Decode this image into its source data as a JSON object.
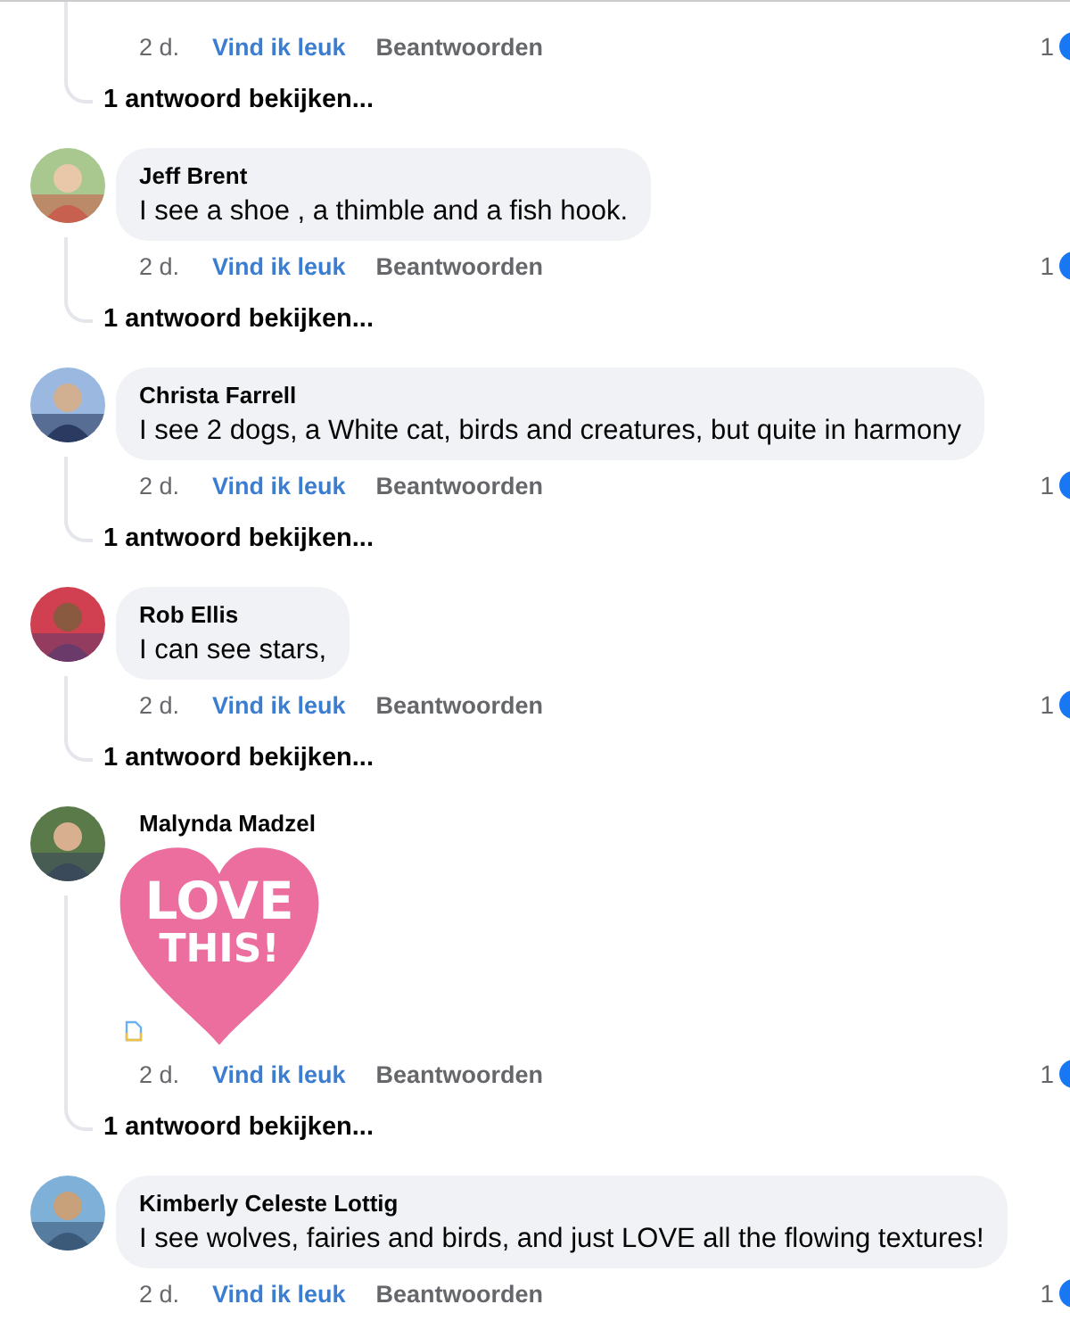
{
  "comments": [
    {
      "kind": "partial",
      "time": "2 d.",
      "like_label": "Vind ik leuk",
      "liked": true,
      "reply_label": "Beantwoorden",
      "reactions": "1",
      "replies_link": "1 antwoord bekijken..."
    },
    {
      "kind": "text",
      "author": "Jeff Brent",
      "text": "I see a shoe , a thimble and a fish hook.",
      "time": "2 d.",
      "like_label": "Vind ik leuk",
      "liked": true,
      "reply_label": "Beantwoorden",
      "reactions": "1",
      "replies_link": "1 antwoord bekijken..."
    },
    {
      "kind": "text",
      "author": "Christa Farrell",
      "text": "I see 2 dogs, a White cat, birds and creatures, but quite in harmony",
      "time": "2 d.",
      "like_label": "Vind ik leuk",
      "liked": true,
      "reply_label": "Beantwoorden",
      "reactions": "1",
      "replies_link": "1 antwoord bekijken..."
    },
    {
      "kind": "text",
      "author": "Rob Ellis",
      "text": "I can see stars,",
      "time": "2 d.",
      "like_label": "Vind ik leuk",
      "liked": true,
      "reply_label": "Beantwoorden",
      "reactions": "1",
      "replies_link": "1 antwoord bekijken..."
    },
    {
      "kind": "sticker",
      "author": "Malynda Madzel",
      "sticker_lines": [
        "LOVE",
        "THIS!"
      ],
      "time": "2 d.",
      "like_label": "Vind ik leuk",
      "liked": true,
      "reply_label": "Beantwoorden",
      "reactions": "1",
      "replies_link": "1 antwoord bekijken..."
    },
    {
      "kind": "text",
      "author": "Kimberly Celeste Lottig",
      "text": "I see wolves, fairies and birds, and just LOVE all the flowing textures!",
      "time": "2 d.",
      "like_label": "Vind ik leuk",
      "liked": true,
      "reply_label": "Beantwoorden",
      "reactions": "1"
    }
  ]
}
